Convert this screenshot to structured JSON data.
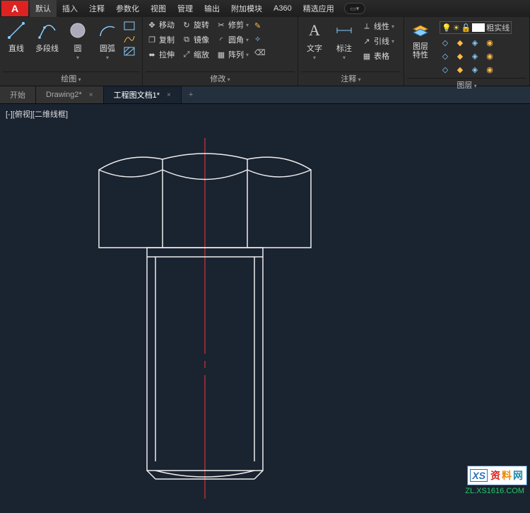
{
  "menu": {
    "app_icon": "A",
    "items": [
      "默认",
      "插入",
      "注释",
      "参数化",
      "视图",
      "管理",
      "输出",
      "附加模块",
      "A360",
      "精选应用"
    ],
    "active_index": 0
  },
  "ribbon": {
    "draw": {
      "label": "绘图",
      "line": "直线",
      "polyline": "多段线",
      "circle": "圆",
      "arc": "圆弧"
    },
    "modify": {
      "label": "修改",
      "move": "移动",
      "rotate": "旋转",
      "trim": "修剪",
      "copy": "复制",
      "mirror": "镜像",
      "fillet": "圆角",
      "stretch": "拉伸",
      "scale": "缩放",
      "array": "阵列"
    },
    "annotation": {
      "label": "注释",
      "text": "文字",
      "dim": "标注",
      "linetype": "线性",
      "leader": "引线",
      "table": "表格"
    },
    "layers": {
      "label": "图层",
      "props": "图层\n特性",
      "option": "粗实线"
    }
  },
  "tabs": {
    "items": [
      {
        "label": "开始",
        "close": false
      },
      {
        "label": "Drawing2*",
        "close": true
      },
      {
        "label": "工程图文档1*",
        "close": true
      }
    ],
    "active_index": 2,
    "add": "+"
  },
  "canvas": {
    "view_label": "[-][俯视][二维线框]"
  },
  "watermark": {
    "badge": "XS",
    "text": "资料网",
    "url": "ZL.XS1616.COM"
  }
}
